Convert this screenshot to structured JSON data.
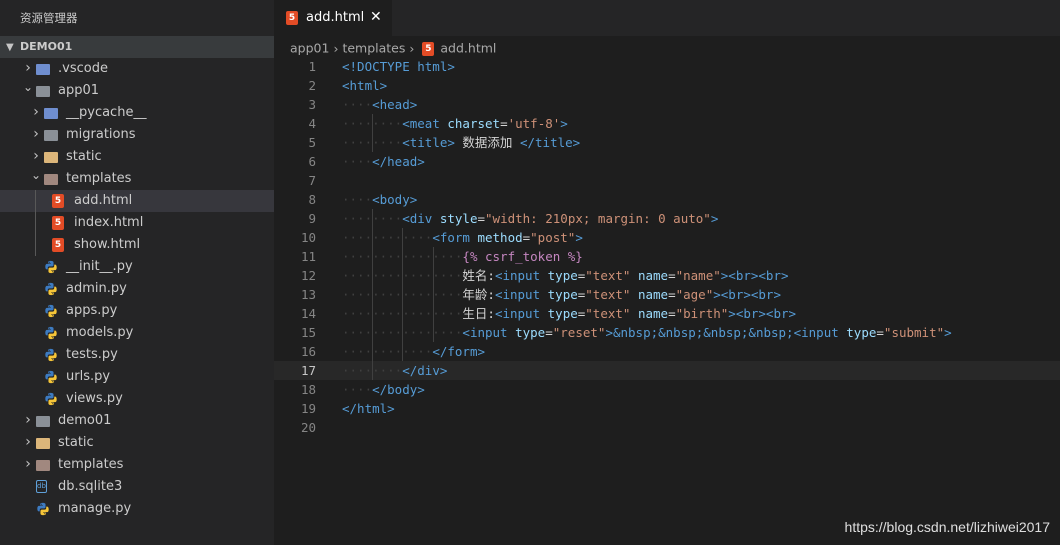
{
  "sidebar": {
    "title": "资源管理器",
    "section": "DEMO01",
    "items": [
      {
        "label": ".vscode",
        "depth": 0,
        "kind": "folder-vscode",
        "chevron": "closed"
      },
      {
        "label": "app01",
        "depth": 0,
        "kind": "folder-open",
        "chevron": "open"
      },
      {
        "label": "__pycache__",
        "depth": 1,
        "kind": "folder-blue",
        "chevron": "closed"
      },
      {
        "label": "migrations",
        "depth": 1,
        "kind": "folder",
        "chevron": "closed"
      },
      {
        "label": "static",
        "depth": 1,
        "kind": "folder-yellow",
        "chevron": "closed"
      },
      {
        "label": "templates",
        "depth": 1,
        "kind": "folder-brown-open",
        "chevron": "open"
      },
      {
        "label": "add.html",
        "depth": 2,
        "kind": "html",
        "selected": true
      },
      {
        "label": "index.html",
        "depth": 2,
        "kind": "html"
      },
      {
        "label": "show.html",
        "depth": 2,
        "kind": "html"
      },
      {
        "label": "__init__.py",
        "depth": 1,
        "kind": "python"
      },
      {
        "label": "admin.py",
        "depth": 1,
        "kind": "python"
      },
      {
        "label": "apps.py",
        "depth": 1,
        "kind": "python"
      },
      {
        "label": "models.py",
        "depth": 1,
        "kind": "python"
      },
      {
        "label": "tests.py",
        "depth": 1,
        "kind": "python"
      },
      {
        "label": "urls.py",
        "depth": 1,
        "kind": "python"
      },
      {
        "label": "views.py",
        "depth": 1,
        "kind": "python"
      },
      {
        "label": "demo01",
        "depth": 0,
        "kind": "folder",
        "chevron": "closed"
      },
      {
        "label": "static",
        "depth": 0,
        "kind": "folder-yellow",
        "chevron": "closed"
      },
      {
        "label": "templates",
        "depth": 0,
        "kind": "folder-brown",
        "chevron": "closed"
      },
      {
        "label": "db.sqlite3",
        "depth": 0,
        "kind": "db"
      },
      {
        "label": "manage.py",
        "depth": 0,
        "kind": "python"
      }
    ]
  },
  "editor": {
    "tab_label": "add.html",
    "tab_close": "✕",
    "breadcrumb": [
      "app01",
      "templates",
      "add.html"
    ],
    "current_line": 17,
    "lines": [
      {
        "n": "1",
        "indent": 0,
        "tokens": [
          [
            "tag",
            "<!DOCTYPE html>"
          ]
        ]
      },
      {
        "n": "2",
        "indent": 0,
        "tokens": [
          [
            "tag",
            "<html>"
          ]
        ]
      },
      {
        "n": "3",
        "indent": 1,
        "tokens": [
          [
            "tag",
            "<head>"
          ]
        ]
      },
      {
        "n": "4",
        "indent": 2,
        "tokens": [
          [
            "tag",
            "<meat "
          ],
          [
            "attr",
            "charset"
          ],
          [
            "plain",
            "="
          ],
          [
            "str",
            "'utf-8'"
          ],
          [
            "tag",
            ">"
          ]
        ]
      },
      {
        "n": "5",
        "indent": 2,
        "tokens": [
          [
            "tag",
            "<title>"
          ],
          [
            "plain",
            " 数据添加 "
          ],
          [
            "tag",
            "</title>"
          ]
        ]
      },
      {
        "n": "6",
        "indent": 1,
        "tokens": [
          [
            "tag",
            "</head>"
          ]
        ]
      },
      {
        "n": "7",
        "indent": 0,
        "tokens": []
      },
      {
        "n": "8",
        "indent": 1,
        "tokens": [
          [
            "tag",
            "<body>"
          ]
        ]
      },
      {
        "n": "9",
        "indent": 2,
        "tokens": [
          [
            "tag",
            "<div "
          ],
          [
            "attr",
            "style"
          ],
          [
            "plain",
            "="
          ],
          [
            "str",
            "\"width: 210px; margin: 0 auto\""
          ],
          [
            "tag",
            ">"
          ]
        ]
      },
      {
        "n": "10",
        "indent": 3,
        "tokens": [
          [
            "tag",
            "<form "
          ],
          [
            "attr",
            "method"
          ],
          [
            "plain",
            "="
          ],
          [
            "str",
            "\"post\""
          ],
          [
            "tag",
            ">"
          ]
        ]
      },
      {
        "n": "11",
        "indent": 4,
        "tokens": [
          [
            "tpl",
            "{% csrf_token %}"
          ]
        ]
      },
      {
        "n": "12",
        "indent": 4,
        "tokens": [
          [
            "plain",
            "姓名:"
          ],
          [
            "tag",
            "<input "
          ],
          [
            "attr",
            "type"
          ],
          [
            "plain",
            "="
          ],
          [
            "str",
            "\"text\" "
          ],
          [
            "attr",
            "name"
          ],
          [
            "plain",
            "="
          ],
          [
            "str",
            "\"name\""
          ],
          [
            "tag",
            "><br><br>"
          ]
        ]
      },
      {
        "n": "13",
        "indent": 4,
        "tokens": [
          [
            "plain",
            "年龄:"
          ],
          [
            "tag",
            "<input "
          ],
          [
            "attr",
            "type"
          ],
          [
            "plain",
            "="
          ],
          [
            "str",
            "\"text\" "
          ],
          [
            "attr",
            "name"
          ],
          [
            "plain",
            "="
          ],
          [
            "str",
            "\"age\""
          ],
          [
            "tag",
            "><br><br>"
          ]
        ]
      },
      {
        "n": "14",
        "indent": 4,
        "tokens": [
          [
            "plain",
            "生日:"
          ],
          [
            "tag",
            "<input "
          ],
          [
            "attr",
            "type"
          ],
          [
            "plain",
            "="
          ],
          [
            "str",
            "\"text\" "
          ],
          [
            "attr",
            "name"
          ],
          [
            "plain",
            "="
          ],
          [
            "str",
            "\"birth\""
          ],
          [
            "tag",
            "><br><br>"
          ]
        ]
      },
      {
        "n": "15",
        "indent": 4,
        "tokens": [
          [
            "tag",
            "<input "
          ],
          [
            "attr",
            "type"
          ],
          [
            "plain",
            "="
          ],
          [
            "str",
            "\"reset\""
          ],
          [
            "tag",
            ">"
          ],
          [
            "ent",
            "&nbsp;&nbsp;&nbsp;&nbsp;"
          ],
          [
            "tag",
            "<input "
          ],
          [
            "attr",
            "type"
          ],
          [
            "plain",
            "="
          ],
          [
            "str",
            "\"submit\""
          ],
          [
            "tag",
            ">"
          ]
        ]
      },
      {
        "n": "16",
        "indent": 3,
        "tokens": [
          [
            "tag",
            "</form>"
          ]
        ]
      },
      {
        "n": "17",
        "indent": 2,
        "tokens": [
          [
            "tag",
            "</div>"
          ]
        ]
      },
      {
        "n": "18",
        "indent": 1,
        "tokens": [
          [
            "tag",
            "</body>"
          ]
        ]
      },
      {
        "n": "19",
        "indent": 0,
        "tokens": [
          [
            "tag",
            "</html>"
          ]
        ]
      },
      {
        "n": "20",
        "indent": 0,
        "tokens": []
      }
    ]
  },
  "watermark": "https://blog.csdn.net/lizhiwei2017",
  "colors": {
    "html_icon": "#e34c26",
    "tag": "#569cd6",
    "attr": "#9cdcfe",
    "string": "#ce9178",
    "template": "#c586c0"
  }
}
